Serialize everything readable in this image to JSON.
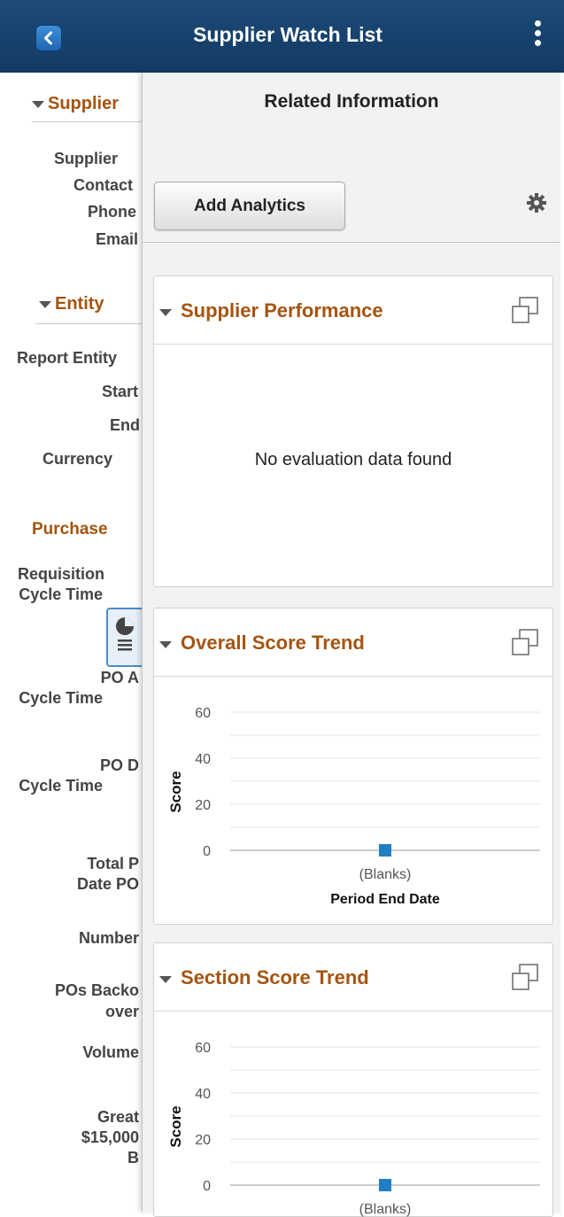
{
  "header": {
    "title": "Supplier Watch List"
  },
  "left": {
    "sections": [
      {
        "title": "Supplier",
        "labels": [
          "Supplier",
          "Contact",
          "Phone",
          "Email"
        ]
      },
      {
        "title": "Entity",
        "labels": [
          "Report Entity",
          "Start",
          "End",
          "Currency"
        ]
      }
    ],
    "purchase_header": "Purchase",
    "metrics": [
      "Requisition",
      "Cycle Time",
      "PO A",
      "Cycle Time",
      "PO D",
      "Cycle Time",
      "Total P",
      "Date PO",
      "Number",
      "POs Backo",
      "over",
      "Volume",
      "Great",
      "$15,000",
      "B"
    ]
  },
  "panel": {
    "title": "Related Information",
    "add_button": "Add Analytics",
    "pagelets": [
      {
        "title": "Supplier Performance",
        "message": "No evaluation data found"
      },
      {
        "title": "Overall Score Trend"
      },
      {
        "title": "Section Score Trend"
      }
    ]
  },
  "chart_data": [
    {
      "type": "line",
      "ylabel": "Score",
      "xlabel": "Period End Date",
      "y_ticks": [
        60,
        40,
        20,
        0
      ],
      "ylim": [
        0,
        60
      ],
      "categories": [
        "(Blanks)"
      ],
      "values": [
        0
      ],
      "grid": true,
      "marker_color": "#1f7ec4"
    },
    {
      "type": "line",
      "ylabel": "Score",
      "xlabel": "",
      "y_ticks": [
        60,
        40,
        20,
        0
      ],
      "ylim": [
        0,
        60
      ],
      "categories": [
        "(Blanks)"
      ],
      "values": [
        0
      ],
      "grid": true,
      "marker_color": "#1f7ec4"
    }
  ]
}
